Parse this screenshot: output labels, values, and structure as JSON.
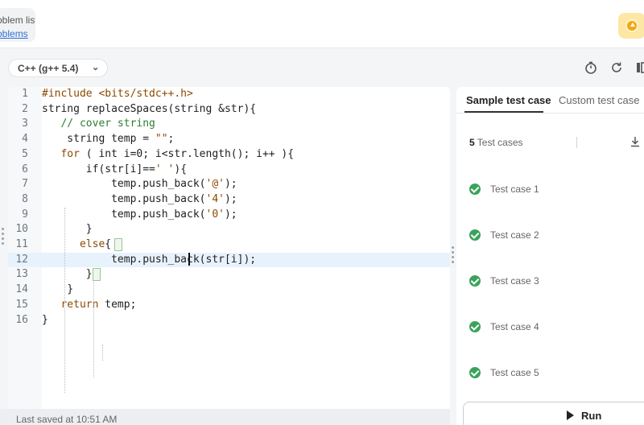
{
  "header": {
    "problem_list_line1": "Problem list",
    "problem_list_line2": "Problems"
  },
  "toolbar": {
    "language": "C++ (g++ 5.4)",
    "icons": [
      "chevron-down-icon",
      "timer-icon",
      "refresh-icon",
      "layout-icon",
      "coin-icon"
    ]
  },
  "editor": {
    "lines": [
      {
        "n": "1",
        "html": "<span class=\"kw\">#include &lt;bits/stdc++.h&gt;</span>"
      },
      {
        "n": "2",
        "html": "string replaceSpaces(string &amp;str){"
      },
      {
        "n": "3",
        "html": "   <span class=\"cm\">// cover string</span>"
      },
      {
        "n": "4",
        "html": "    string temp = <span class=\"st\">\"\"</span>;"
      },
      {
        "n": "5",
        "html": "   <span class=\"kw\">for</span> ( int i=0; i&lt;str.length(); i++ ){"
      },
      {
        "n": "6",
        "html": "       if(str[i]==<span class=\"st\">' '</span>){"
      },
      {
        "n": "7",
        "html": "           temp.push_back(<span class=\"st\">'@'</span>);"
      },
      {
        "n": "8",
        "html": "           temp.push_back(<span class=\"st\">'4'</span>);"
      },
      {
        "n": "9",
        "html": "           temp.push_back(<span class=\"st\">'0'</span>);"
      },
      {
        "n": "10",
        "html": "       }"
      },
      {
        "n": "11",
        "html": "      <span class=\"kw\">else</span>{"
      },
      {
        "n": "12",
        "html": "           temp.push_back(str[i]);"
      },
      {
        "n": "13",
        "html": "       }"
      },
      {
        "n": "14",
        "html": "    }"
      },
      {
        "n": "15",
        "html": "   <span class=\"kw\">return</span> temp;"
      },
      {
        "n": "16",
        "html": "}"
      }
    ],
    "active_line": 12,
    "status": "Last saved at 10:51 AM"
  },
  "panel": {
    "tabs": [
      "Sample test case",
      "Custom test case"
    ],
    "count_number": "5",
    "count_label": " Test cases",
    "cases": [
      "Test case 1",
      "Test case 2",
      "Test case 3",
      "Test case 4",
      "Test case 5"
    ],
    "run_label": "Run"
  },
  "colors": {
    "accent": "#3aa35b",
    "active_line": "#e8f2fd",
    "coin": "#f3a712"
  }
}
